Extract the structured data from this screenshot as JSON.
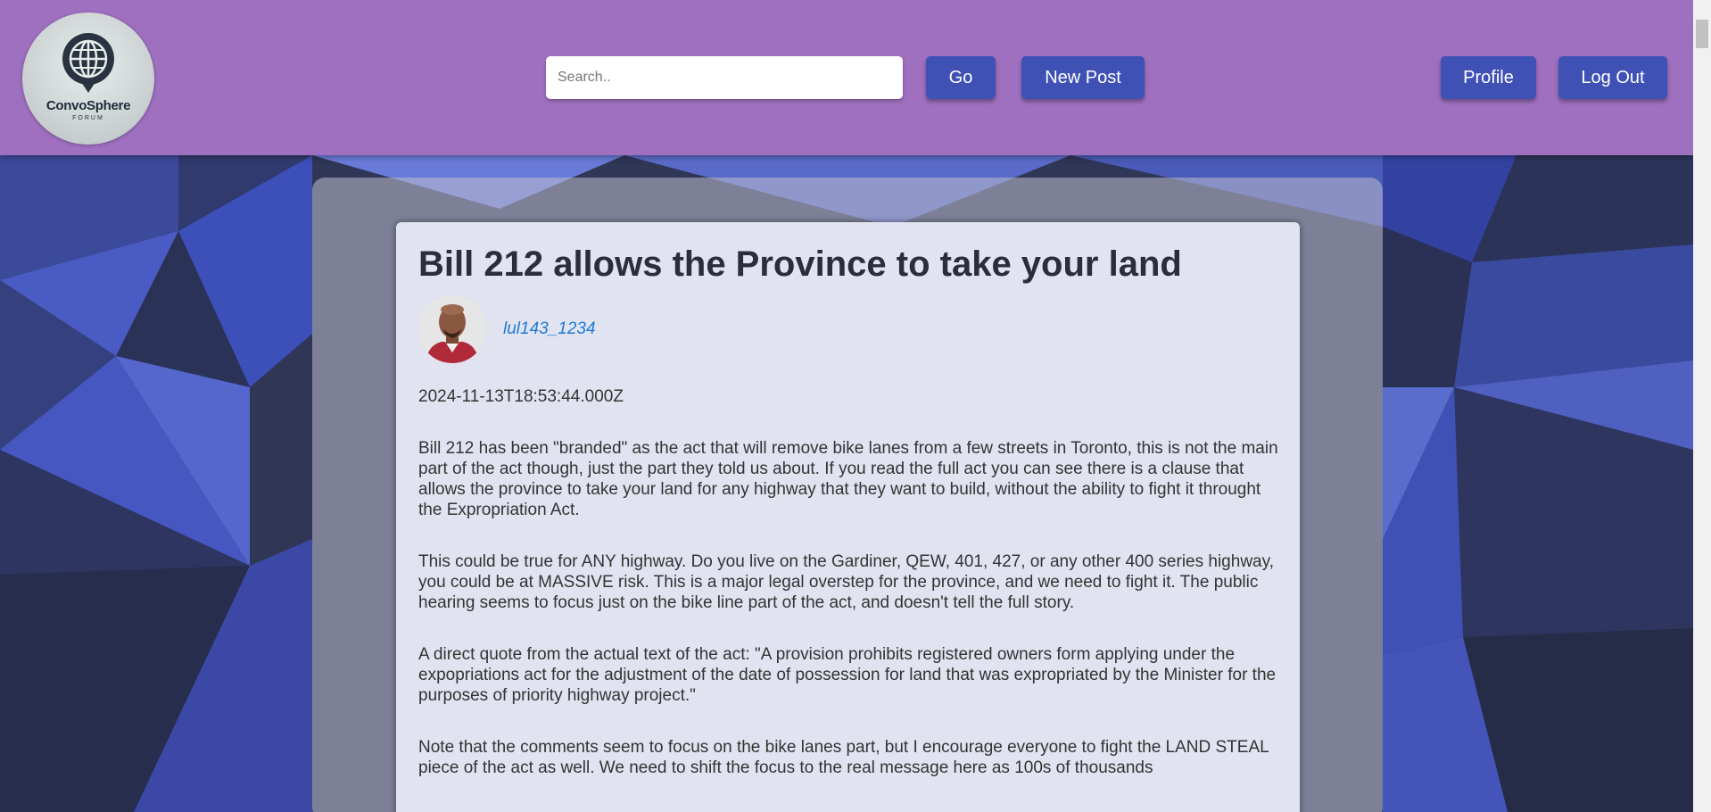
{
  "header": {
    "logo": {
      "name": "ConvoSphere",
      "subtitle": "FORUM"
    },
    "search": {
      "placeholder": "Search..",
      "value": ""
    },
    "go_label": "Go",
    "new_post_label": "New Post",
    "profile_label": "Profile",
    "logout_label": "Log Out"
  },
  "post": {
    "title": "Bill 212 allows the Province to take your land",
    "author": "lul143_1234",
    "timestamp": "2024-11-13T18:53:44.000Z",
    "paragraphs": [
      "Bill 212 has been \"branded\" as the act that will remove bike lanes from a few streets in Toronto, this is not the main part of the act though, just the part they told us about. If you read the full act you can see there is a clause that allows the province to take your land for any highway that they want to build, without the ability to fight it throught the Expropriation Act.",
      "This could be true for ANY highway. Do you live on the Gardiner, QEW, 401, 427, or any other 400 series highway, you could be at MASSIVE risk. This is a major legal overstep for the province, and we need to fight it. The public hearing seems to focus just on the bike line part of the act, and doesn't tell the full story.",
      "A direct quote from the actual text of the act: \"A provision prohibits registered owners form applying under the expopriations act for the adjustment of the date of possession for land that was expropriated by the Minister for the purposes of priority highway project.\"",
      "Note that the comments seem to focus on the bike lanes part, but I encourage everyone to fight the LAND STEAL piece of the act as well. We need to shift the focus to the real message here as 100s of thousands"
    ]
  },
  "colors": {
    "header_bg": "#a070c0",
    "button_bg": "#3f51b5",
    "card_bg": "#e1e4f0",
    "link": "#1e7ad8"
  }
}
